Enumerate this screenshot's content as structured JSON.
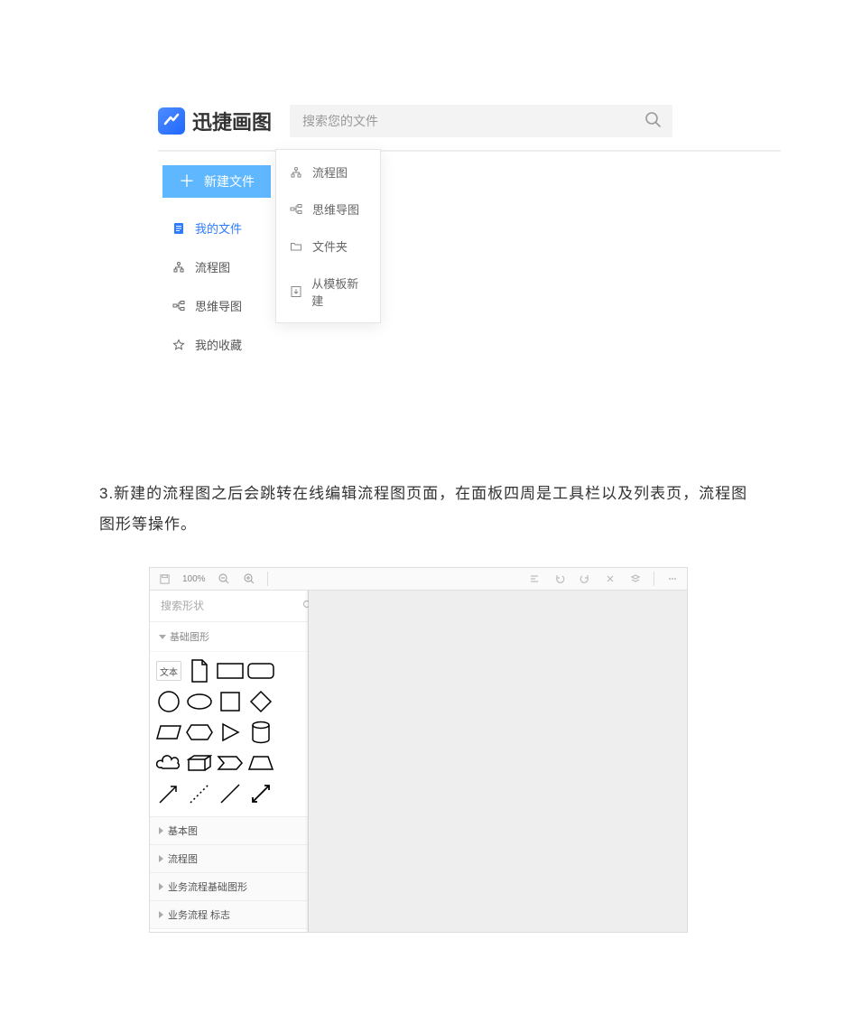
{
  "shot1": {
    "logo_text": "迅捷画图",
    "search_placeholder": "搜索您的文件",
    "new_file_label": "新建文件",
    "nav": [
      {
        "label": "我的文件",
        "icon": "doc",
        "active": true
      },
      {
        "label": "流程图",
        "icon": "flow",
        "active": false
      },
      {
        "label": "思维导图",
        "icon": "mind",
        "active": false
      },
      {
        "label": "我的收藏",
        "icon": "star",
        "active": false
      }
    ],
    "flyout": [
      {
        "label": "流程图",
        "icon": "flow"
      },
      {
        "label": "思维导图",
        "icon": "mind"
      },
      {
        "label": "文件夹",
        "icon": "folder"
      },
      {
        "label": "从模板新建",
        "icon": "template"
      }
    ]
  },
  "caption": "3.新建的流程图之后会跳转在线编辑流程图页面，在面板四周是工具栏以及列表页，流程图图形等操作。",
  "shot2": {
    "zoom_label": "100%",
    "shape_search_placeholder": "搜索形状",
    "open_section": "基础图形",
    "text_shape_label": "文本",
    "collapsed_sections": [
      "基本图",
      "流程图",
      "业务流程基础图形",
      "业务流程 标志"
    ]
  }
}
